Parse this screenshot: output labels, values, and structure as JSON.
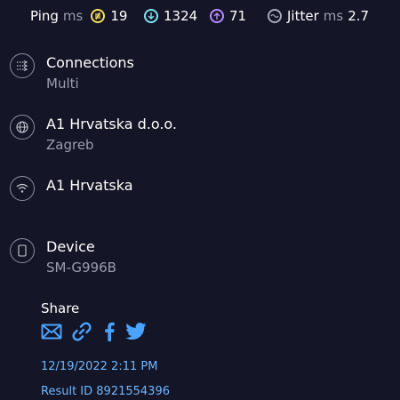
{
  "header": {
    "ping_label": "Ping",
    "ping_unit": "ms",
    "idle_latency": "19",
    "download_latency": "1324",
    "upload_latency": "71",
    "jitter_label": "Jitter",
    "jitter_unit": "ms",
    "jitter_value": "2.7",
    "colors": {
      "idle": "#f3e15a",
      "download": "#7ee4f0",
      "upload": "#b78cff",
      "jitter": "#a7a9bd"
    }
  },
  "details": [
    {
      "icon": "connections-icon",
      "title": "Connections",
      "subtitle": "Multi"
    },
    {
      "icon": "globe-icon",
      "title": "A1 Hrvatska d.o.o.",
      "subtitle": "Zagreb"
    },
    {
      "icon": "wifi-icon",
      "title": "A1 Hrvatska",
      "subtitle": ""
    },
    {
      "icon": "device-icon",
      "title": "Device",
      "subtitle": "SM-G996B"
    }
  ],
  "share": {
    "label": "Share",
    "icons": [
      "email-icon",
      "link-icon",
      "facebook-icon",
      "twitter-icon"
    ],
    "icon_color": "#4aa3ff"
  },
  "result": {
    "date": "12/19/2022 2:11 PM",
    "result_id": "Result ID 8921554396",
    "link_color": "#6fb7ff"
  }
}
